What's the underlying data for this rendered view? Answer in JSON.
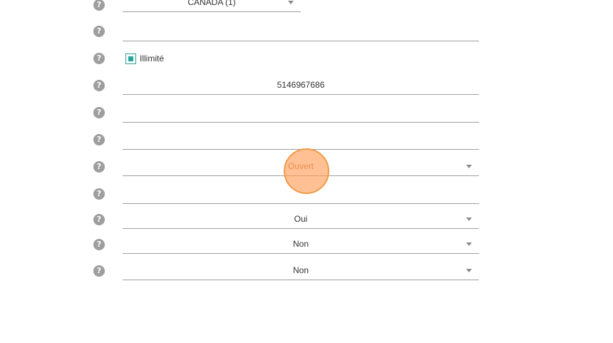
{
  "icons": {
    "help": "question-mark-circle",
    "help_glyph": "?"
  },
  "colors": {
    "accent": "#26a69a",
    "help_icon": "#9e9e9e",
    "click_indicator": "#f19a45",
    "underline": "#9e9e9e"
  },
  "form": {
    "country": {
      "value": "CANADA (1)"
    },
    "field_2": {
      "value": ""
    },
    "unlimited": {
      "label": "Illimité",
      "checked": true
    },
    "phone": {
      "value": "5146967686"
    },
    "field_5": {
      "value": ""
    },
    "field_6": {
      "value": ""
    },
    "status": {
      "value": "Ouvert"
    },
    "field_8": {
      "value": ""
    },
    "select_oui": {
      "value": "Oui"
    },
    "select_non_1": {
      "value": "Non"
    },
    "select_non_2": {
      "value": "Non"
    }
  }
}
